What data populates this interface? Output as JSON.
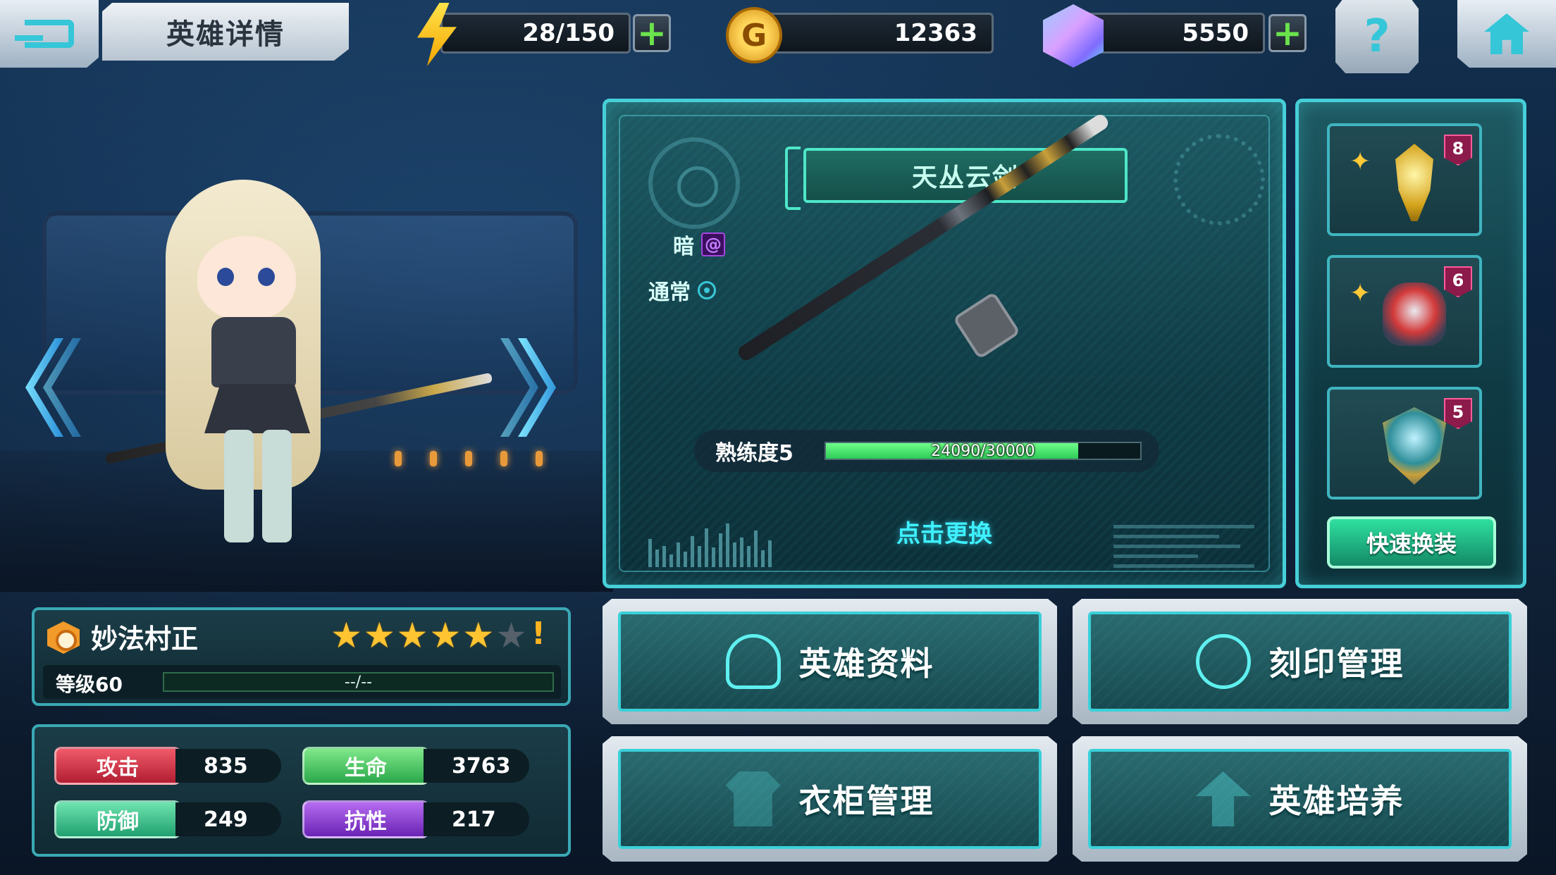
{
  "header": {
    "title": "英雄详情",
    "energy": "28/150",
    "gold": "12363",
    "gems": "5550",
    "gold_symbol": "G",
    "help_symbol": "?"
  },
  "weapon": {
    "name": "天丛云剑",
    "element_label": "暗",
    "element_icon": "dark-swirl-icon",
    "attack_type_label": "通常",
    "mastery_label": "熟练度5",
    "mastery_value": "24090/30000",
    "mastery_current": 24090,
    "mastery_max": 30000,
    "change_label": "点击更换"
  },
  "equipment": {
    "slots": [
      {
        "icon": "golden-ornament-icon",
        "level": "8"
      },
      {
        "icon": "red-gauntlet-icon",
        "level": "6"
      },
      {
        "icon": "shield-emblem-icon",
        "level": "5"
      }
    ],
    "quick_equip_label": "快速换装",
    "star_symbol": "✦"
  },
  "hero": {
    "name": "妙法村正",
    "stars_filled": 5,
    "stars_total": 6,
    "warning": "!",
    "level_label": "等级60",
    "exp_text": "--/--",
    "stats": {
      "attack_label": "攻击",
      "attack": "835",
      "hp_label": "生命",
      "hp": "3763",
      "defense_label": "防御",
      "defense": "249",
      "resist_label": "抗性",
      "resist": "217"
    }
  },
  "actions": {
    "profile": "英雄资料",
    "seal": "刻印管理",
    "wardrobe": "衣柜管理",
    "train": "英雄培养"
  },
  "colors": {
    "accent": "#46cfd8",
    "mastery_fill": "#2ecb58",
    "star": "#ffc432"
  }
}
